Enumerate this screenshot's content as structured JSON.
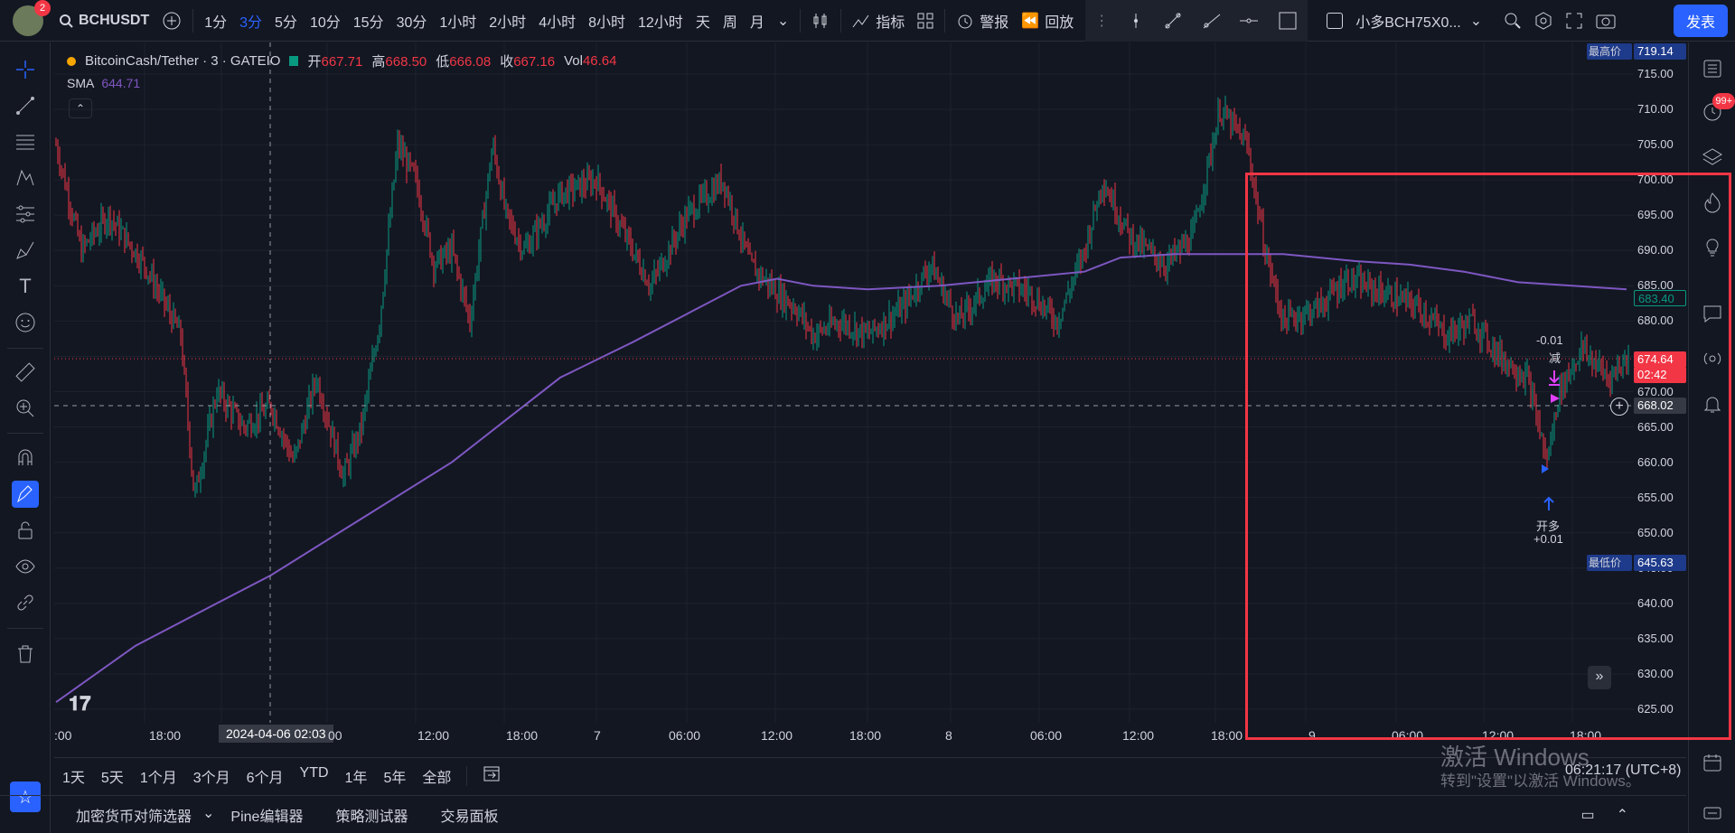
{
  "topbar": {
    "avatar_badge": "2",
    "symbol": "BCHUSDT",
    "intervals": [
      "1分",
      "3分",
      "5分",
      "10分",
      "15分",
      "30分",
      "1小时",
      "2小时",
      "4小时",
      "8小时",
      "12小时",
      "天",
      "周",
      "月"
    ],
    "active_interval": "3分",
    "indicators_label": "指标",
    "alert_label": "警报",
    "replay_label": "回放",
    "layout_name": "小多BCH75X0...",
    "publish_label": "发表"
  },
  "legend": {
    "title": "BitcoinCash/Tether · 3 · GATEIO",
    "open_label": "开",
    "open": "667.71",
    "high_label": "高",
    "high": "668.50",
    "low_label": "低",
    "low": "666.08",
    "close_label": "收",
    "close": "667.16",
    "vol_label": "Vol",
    "vol": "46.64",
    "sma_label": "SMA",
    "sma_value": "644.71"
  },
  "price_scale": {
    "labels": [
      "715.00",
      "710.00",
      "705.00",
      "700.00",
      "695.00",
      "690.00",
      "685.00",
      "680.00",
      "675.00",
      "670.00",
      "665.00",
      "660.00",
      "655.00",
      "650.00",
      "645.00",
      "640.00",
      "635.00",
      "630.00",
      "625.00"
    ],
    "highest_label": "最高价",
    "highest": "719.14",
    "lowest_label": "最低价",
    "lowest": "645.63",
    "sma_tag": "683.40",
    "current_price": "674.64",
    "countdown": "02:42",
    "crosshair_price": "668.02",
    "plus_icon": "+"
  },
  "time_scale": {
    "labels": [
      ":00",
      "18:00",
      "2024-04-06  02:03",
      "00",
      "12:00",
      "18:00",
      "7",
      "06:00",
      "12:00",
      "18:00",
      "8",
      "06:00",
      "12:00",
      "18:00",
      "9",
      "06:00",
      "12:00",
      "18:00"
    ]
  },
  "annotations": {
    "sell_qty": "-0.01",
    "sell_label": "减",
    "buy_label": "开多",
    "buy_qty": "+0.01"
  },
  "bottom": {
    "ranges": [
      "1天",
      "5天",
      "1个月",
      "3个月",
      "6个月",
      "YTD",
      "1年",
      "5年",
      "全部"
    ],
    "clock": "06:21:17 (UTC+8)",
    "watermark_line1": "激活 Windows",
    "watermark_line2": "转到\"设置\"以激活 Windows。"
  },
  "panels": {
    "tabs": [
      "加密货币对筛选器",
      "Pine编辑器",
      "策略测试器",
      "交易面板"
    ]
  },
  "right_badge": "99+",
  "colors": {
    "up": "#089981",
    "down": "#f23645",
    "sma": "#7e57c2",
    "accent": "#2962ff",
    "highlight": "#f23645"
  }
}
